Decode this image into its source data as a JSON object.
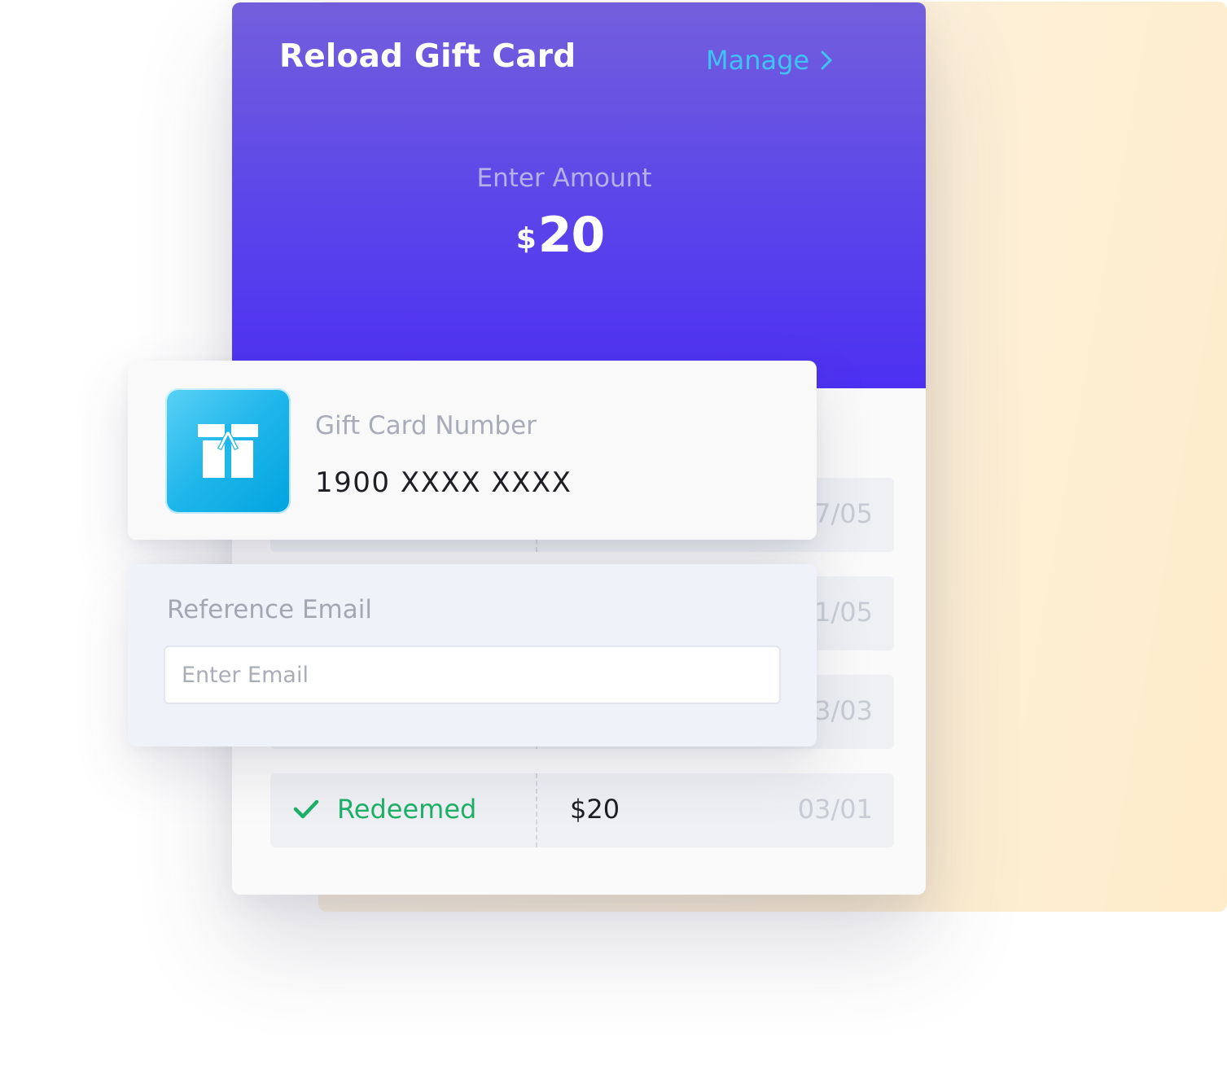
{
  "card": {
    "title": "Reload Gift Card",
    "manage_label": "Manage",
    "amount_label": "Enter Amount",
    "currency": "$",
    "amount": "20"
  },
  "gift_card": {
    "label": "Gift Card Number",
    "number": "1900 XXXX XXXX"
  },
  "reference_email": {
    "label": "Reference Email",
    "placeholder": "Enter Email",
    "value": ""
  },
  "history": [
    {
      "date": "7/05"
    },
    {
      "date": "1/05"
    },
    {
      "date": "3/03"
    },
    {
      "status": "Redeemed",
      "amount": "$20",
      "date": "03/01"
    }
  ],
  "colors": {
    "header_top": "#735fdc",
    "header_bottom": "#4d30f2",
    "manage_link": "#3fc3f7",
    "redeemed_green": "#1db168",
    "gift_icon": "#1fb6ea"
  },
  "icons": {
    "manage_chevron": "chevron-right-icon",
    "redeemed_check": "check-icon",
    "gift": "gift-box-icon"
  }
}
